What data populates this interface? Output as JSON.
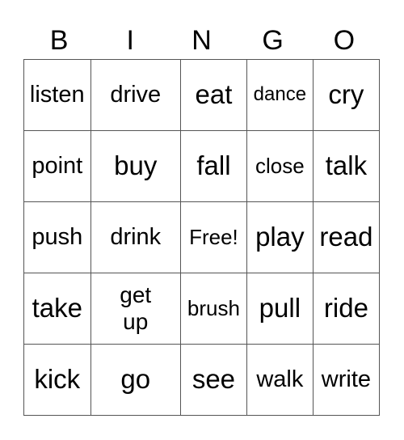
{
  "header": [
    "B",
    "I",
    "N",
    "G",
    "O"
  ],
  "rows": [
    [
      "listen",
      "drive",
      "eat",
      "dance",
      "cry"
    ],
    [
      "point",
      "buy",
      "fall",
      "close",
      "talk"
    ],
    [
      "push",
      "drink",
      "Free!",
      "play",
      "read"
    ],
    [
      "take",
      "get up",
      "brush",
      "pull",
      "ride"
    ],
    [
      "kick",
      "go",
      "see",
      "walk",
      "write"
    ]
  ]
}
